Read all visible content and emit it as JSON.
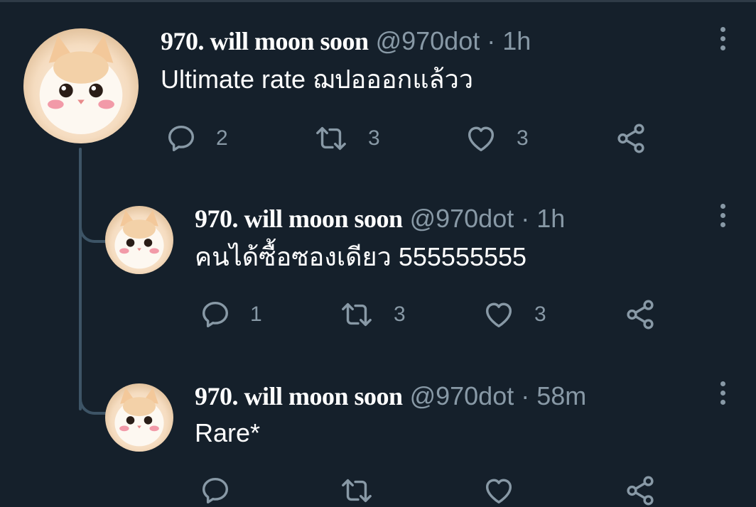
{
  "tweets": [
    {
      "name": "970. will moon soon",
      "handle": "@970dot",
      "separator": "·",
      "time": "1h",
      "text": "Ultimate rate ฌปอออกแล้วว",
      "replies": "2",
      "retweets": "3",
      "likes": "3"
    },
    {
      "name": "970. will moon soon",
      "handle": "@970dot",
      "separator": "·",
      "time": "1h",
      "text": "คนได้ซื้อซองเดียว 555555555",
      "replies": "1",
      "retweets": "3",
      "likes": "3"
    },
    {
      "name": "970. will moon soon",
      "handle": "@970dot",
      "separator": "·",
      "time": "58m",
      "text": "Rare*",
      "replies": "",
      "retweets": "",
      "likes": ""
    }
  ],
  "icons": {
    "reply": "reply-icon",
    "retweet": "retweet-icon",
    "like": "heart-icon",
    "share": "share-icon",
    "more": "more-options-icon"
  },
  "colors": {
    "background": "#15202b",
    "secondary_text": "#8899a6",
    "thread_line": "#3d5466"
  }
}
